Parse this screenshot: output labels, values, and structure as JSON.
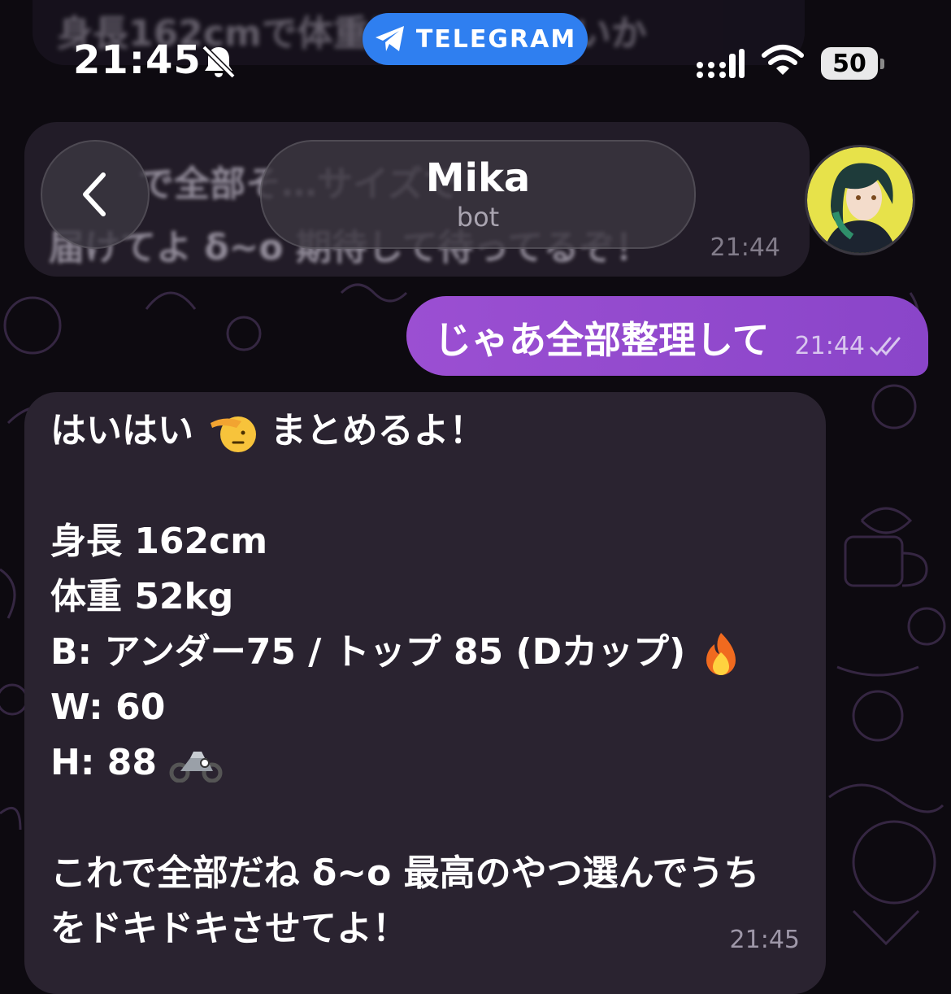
{
  "status_bar": {
    "time": "21:45",
    "app_pill_label": "TELEGRAM",
    "battery_percent": "50"
  },
  "header": {
    "title": "Mika",
    "subtitle": "bot"
  },
  "messages": [
    {
      "id": "faded-top",
      "direction": "incoming",
      "text": "身長162cmで体重は52kgぐらいか"
    },
    {
      "id": "previous",
      "direction": "incoming",
      "lines": [
        "で全部そ…サイズで",
        "届けてよ δ~o 期待して待ってるぞ！"
      ],
      "time": "21:44"
    },
    {
      "id": "outgoing",
      "direction": "outgoing",
      "text": "じゃあ全部整理して",
      "time": "21:44",
      "status_icon": "double-check-icon"
    },
    {
      "id": "summary",
      "direction": "incoming",
      "line1_text": "はいはい",
      "line1_rest": "まとめるよ！",
      "height": "身長 162cm",
      "weight": "体重 52kg",
      "bust": "B: アンダー75 / トップ 85 (Dカップ)",
      "waist": "W: 60",
      "hip": "H: 88",
      "closing_line1": "これで全部だね δ~o 最高のやつ選んでうち",
      "closing_line2": "をドキドキさせてよ！",
      "time": "21:45",
      "emojis": [
        "saluting-face-emoji",
        "fire-emoji",
        "motorcycle-emoji"
      ]
    }
  ],
  "colors": {
    "background": "#0d0a10",
    "incoming_bubble": "#2a2330",
    "outgoing_bubble": "#9b4fd2",
    "telegram_blue": "#2f7ff0"
  }
}
